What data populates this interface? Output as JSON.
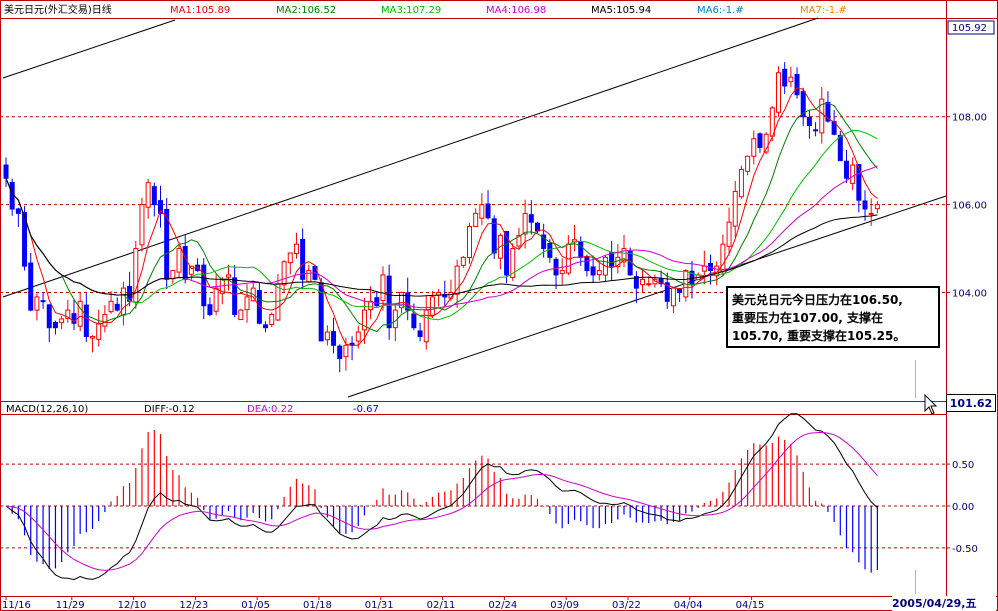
{
  "header": {
    "title": "美元日元(外汇交易)日线",
    "ma": [
      {
        "label": "MA1:105.89",
        "color": "#ff0000"
      },
      {
        "label": "MA2:106.52",
        "color": "#008000"
      },
      {
        "label": "MA3:107.29",
        "color": "#00c000"
      },
      {
        "label": "MA4:106.98",
        "color": "#d000d0"
      },
      {
        "label": "MA5:105.94",
        "color": "#000000"
      },
      {
        "label": "MA6:-1.#",
        "color": "#0080c0"
      },
      {
        "label": "MA7:-1.#",
        "color": "#ff8000"
      }
    ]
  },
  "macd_header": {
    "name": "MACD(12,26,10)",
    "diff": "DIFF:-0.12",
    "dea": "DEA:0.22",
    "macd": "-0.67"
  },
  "note": {
    "line1": "美元兑日元今日压力在106.50,",
    "line2": "重要压力在107.00, 支撑在",
    "line3": "105.70, 重要支撑在105.25。"
  },
  "price_marker": "101.62",
  "date_marker": "2005/04/29,五",
  "colors": {
    "up": "#ff0000",
    "down": "#0000ff",
    "grid": "#c00000",
    "bg": "#ffffff"
  },
  "chart_data": [
    {
      "type": "candlestick",
      "title": "美元日元(外汇交易)日线",
      "y_ticks": [
        "108.00",
        "106.00",
        "104.00"
      ],
      "y_top_label": "105.92",
      "ylim": [
        101.6,
        110.2
      ],
      "x_ticks": [
        "11/16",
        "11/29",
        "12/10",
        "12/23",
        "01/05",
        "01/18",
        "01/31",
        "02/11",
        "02/24",
        "03/09",
        "03/22",
        "04/04",
        "04/15"
      ],
      "close": [
        106.6,
        105.9,
        105.8,
        104.6,
        103.6,
        103.9,
        103.8,
        103.2,
        103.2,
        103.4,
        103.6,
        103.3,
        103.8,
        103.0,
        103.0,
        103.3,
        103.5,
        103.8,
        103.6,
        104.1,
        103.8,
        105.0,
        106.0,
        106.5,
        106.0,
        105.8,
        104.3,
        104.5,
        105.0,
        104.3,
        104.6,
        104.5,
        103.7,
        103.5,
        104.1,
        104.3,
        104.4,
        103.5,
        103.6,
        103.9,
        104.1,
        103.3,
        103.2,
        103.5,
        104.2,
        104.7,
        104.9,
        105.1,
        104.3,
        104.5,
        104.3,
        102.9,
        103.1,
        102.8,
        102.5,
        102.8,
        102.8,
        103.1,
        103.6,
        103.8,
        103.7,
        104.4,
        103.2,
        103.6,
        104.0,
        103.6,
        103.2,
        103.0,
        103.6,
        103.9,
        104.0,
        103.9,
        104.0,
        104.6,
        104.8,
        105.5,
        105.8,
        106.0,
        105.7,
        104.9,
        105.3,
        104.4,
        105.0,
        105.3,
        105.8,
        105.6,
        105.4,
        105.0,
        104.8,
        104.4,
        104.5,
        105.1,
        105.2,
        104.8,
        104.5,
        104.4,
        104.5,
        104.8,
        104.6,
        104.8,
        105.0,
        104.4,
        104.1,
        104.3,
        104.2,
        104.3,
        104.2,
        103.8,
        104.1,
        104.0,
        104.5,
        104.2,
        104.4,
        104.6,
        104.5,
        104.6,
        105.1,
        105.6,
        106.3,
        106.8,
        107.1,
        107.5,
        107.3,
        107.6,
        108.2,
        109.0,
        108.7,
        108.9,
        108.5,
        108.0,
        107.8,
        107.7,
        108.4,
        107.9,
        107.6,
        107.0,
        106.6,
        106.9,
        106.1,
        105.9,
        105.8,
        106.0
      ],
      "ma_windows": [
        5,
        10,
        20,
        30,
        60
      ],
      "ma_colors": [
        "#ff0000",
        "#008000",
        "#00c000",
        "#d000d0",
        "#000000"
      ]
    },
    {
      "type": "bar",
      "title": "MACD(12,26,10)",
      "y_ticks": [
        "0.50",
        "0.00",
        "-0.50"
      ],
      "ylim": [
        -1.05,
        1.05
      ],
      "series": [
        {
          "name": "DIFF",
          "color": "#000000"
        },
        {
          "name": "DEA",
          "color": "#d000d0"
        }
      ]
    }
  ]
}
